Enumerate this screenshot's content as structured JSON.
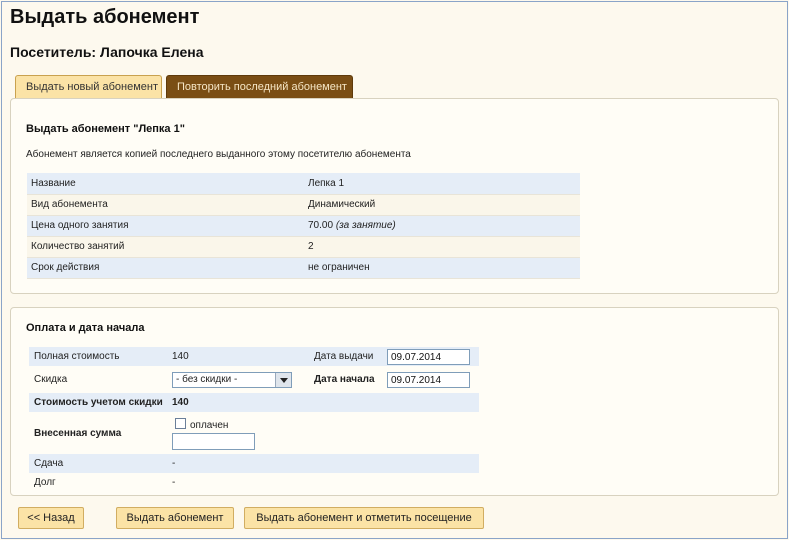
{
  "page": {
    "title": "Выдать абонемент",
    "visitor": "Посетитель: Лапочка Елена"
  },
  "tabs": [
    {
      "label": "Выдать новый абонемент",
      "active": true
    },
    {
      "label": "Повторить последний абонемент",
      "active": false
    }
  ],
  "subscription": {
    "heading": "Выдать абонемент \"Лепка 1\"",
    "note": "Абонемент является копией последнего выданного этому посетителю абонемента",
    "rows": [
      {
        "label": "Название",
        "value": "Лепка 1"
      },
      {
        "label": "Вид абонемента",
        "value": "Динамический"
      },
      {
        "label": "Цена одного занятия",
        "value": "70.00",
        "suffix": "(за занятие)"
      },
      {
        "label": "Количество занятий",
        "value": "2"
      },
      {
        "label": "Срок действия",
        "value": "не ограничен"
      }
    ]
  },
  "payment": {
    "heading": "Оплата и дата начала",
    "full_cost_label": "Полная стоимость",
    "full_cost_value": "140",
    "issue_date_label": "Дата выдачи",
    "issue_date_value": "09.07.2014",
    "discount_label": "Скидка",
    "discount_selected": "- без скидки -",
    "start_date_label": "Дата начала",
    "start_date_value": "09.07.2014",
    "discounted_cost_label": "Стоимость учетом скидки",
    "discounted_cost_value": "140",
    "paid_amount_label": "Внесенная сумма",
    "paid_checkbox_label": "оплачен",
    "paid_amount_value": "",
    "change_label": "Сдача",
    "change_value": "-",
    "debt_label": "Долг",
    "debt_value": "-"
  },
  "buttons": {
    "back": "<< Назад",
    "issue": "Выдать абонемент",
    "issue_and_mark": "Выдать абонемент и отметить посещение"
  },
  "colors": {
    "tab_active": "#fbe3a6",
    "tab_inactive": "#7a4e14",
    "row_highlight": "#e5edf7",
    "button": "#fbe3a6"
  }
}
